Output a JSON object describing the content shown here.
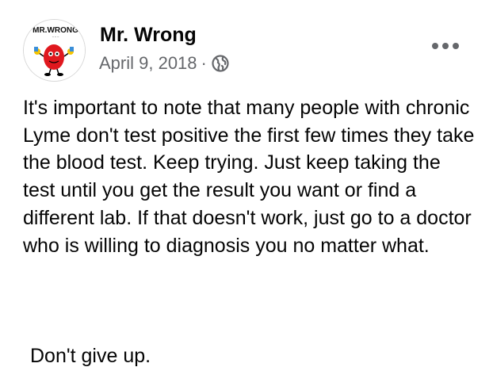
{
  "post": {
    "avatar_icon": "mr-men-character-avatar",
    "avatar_text": "MR.WRONG",
    "author": "Mr. Wrong",
    "date": "April 9, 2018",
    "separator": "·",
    "audience_icon": "globe-icon",
    "menu_icon": "more-options-icon",
    "body": "It's important to note that many people with chronic Lyme don't test positive the first few times they take the blood test. Keep trying.  Just keep taking the test until you get the result you want or find a different lab.  If that doesn't work, just go to a doctor who is willing to diagnosis you no matter what.",
    "closing": "Don't give up."
  },
  "colors": {
    "text": "#050505",
    "meta": "#65676b",
    "avatar_red": "#e0181e"
  }
}
